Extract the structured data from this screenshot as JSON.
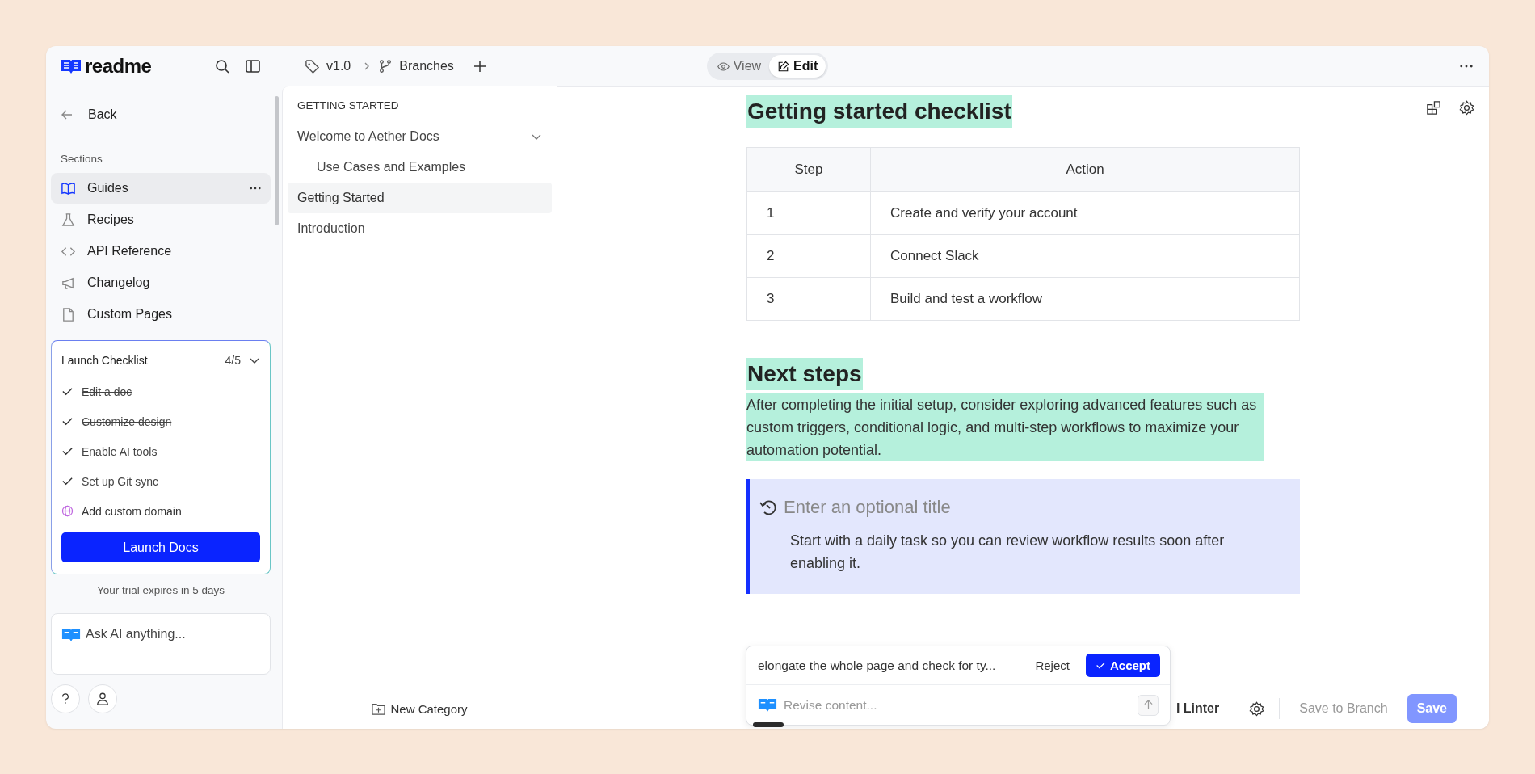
{
  "brand": {
    "name": "readme"
  },
  "breadcrumb": {
    "version": "v1.0",
    "branches": "Branches"
  },
  "mode_toggle": [
    {
      "label": "View",
      "selected": false
    },
    {
      "label": "Edit",
      "selected": true
    }
  ],
  "sidebar": {
    "back": "Back",
    "sections_label": "Sections",
    "items": [
      {
        "label": "Guides",
        "selected": true
      },
      {
        "label": "Recipes",
        "selected": false
      },
      {
        "label": "API Reference",
        "selected": false
      },
      {
        "label": "Changelog",
        "selected": false
      },
      {
        "label": "Custom Pages",
        "selected": false
      }
    ],
    "checklist": {
      "title": "Launch Checklist",
      "count": "4/5",
      "expanded": true,
      "items": [
        {
          "label": "Edit a doc",
          "checked": true
        },
        {
          "label": "Customize design",
          "checked": true
        },
        {
          "label": "Enable AI tools",
          "checked": true
        },
        {
          "label": "Set up Git sync",
          "checked": true
        },
        {
          "label": "Add custom domain",
          "checked": false
        }
      ],
      "button": "Launch Docs"
    },
    "trial_notice": "Your trial expires in 5 days",
    "ask_ai": {
      "placeholder": "Ask AI anything..."
    }
  },
  "nav": {
    "heading": "GETTING STARTED",
    "pages": [
      {
        "label": "Welcome to Aether Docs",
        "selected": false,
        "expanded": true,
        "children": [
          {
            "label": "Use Cases and Examples",
            "selected": false
          }
        ]
      },
      {
        "label": "Getting Started",
        "selected": true
      },
      {
        "label": "Introduction",
        "selected": false
      }
    ],
    "new_category": "New Category"
  },
  "content": {
    "heading": "Getting started checklist",
    "table": {
      "columns": [
        "Step",
        "Action"
      ],
      "rows": [
        [
          "1",
          "Create and verify your account"
        ],
        [
          "2",
          "Connect Slack"
        ],
        [
          "3",
          "Build and test a workflow"
        ]
      ]
    },
    "next_heading": "Next steps",
    "paragraph": "After completing the initial setup, consider exploring advanced features such as custom triggers, conditional logic, and multi-step workflows to maximize your automation potential.",
    "callout": {
      "title_placeholder": "Enter an optional title",
      "body": "Start with a daily task so you can review workflow results soon after enabling it."
    }
  },
  "ai_popup": {
    "prompt": "elongate the whole page and check for ty...",
    "reject": "Reject",
    "accept": "Accept",
    "placeholder": "Revise content..."
  },
  "footer": {
    "linter": "l Linter",
    "save_to_branch": "Save to Branch",
    "save": "Save",
    "save_disabled": true
  }
}
